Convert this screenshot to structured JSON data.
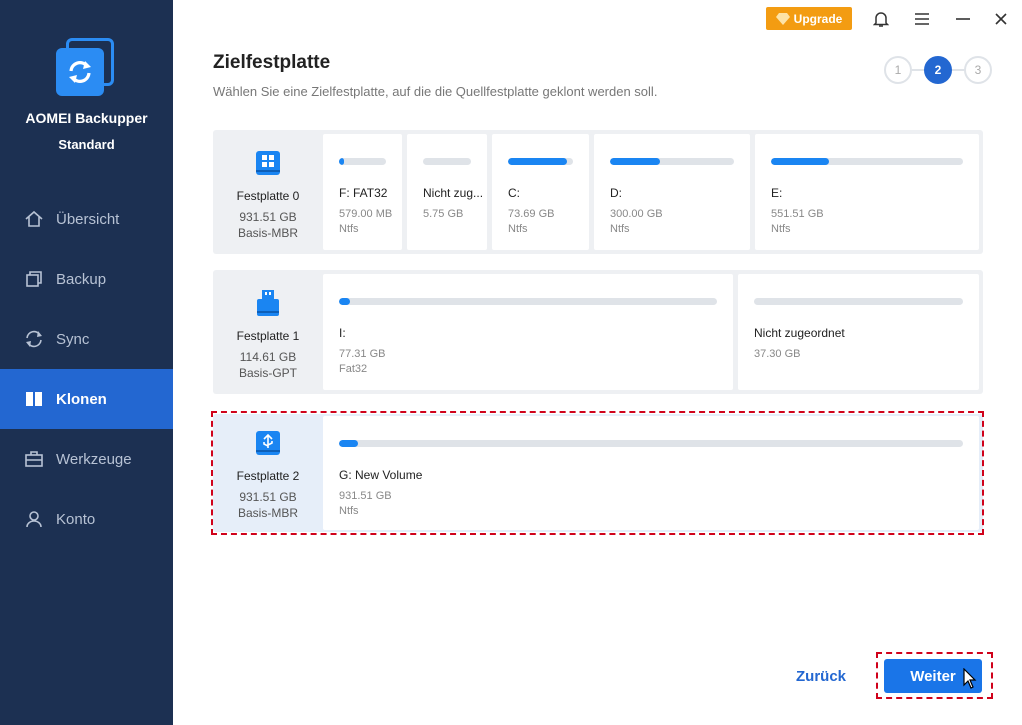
{
  "app": {
    "name": "AOMEI Backupper",
    "edition": "Standard"
  },
  "sidebar": {
    "items": [
      {
        "label": "Übersicht",
        "icon": "home-icon"
      },
      {
        "label": "Backup",
        "icon": "backup-icon"
      },
      {
        "label": "Sync",
        "icon": "sync-icon"
      },
      {
        "label": "Klonen",
        "icon": "clone-icon",
        "active": true
      },
      {
        "label": "Werkzeuge",
        "icon": "toolbox-icon"
      },
      {
        "label": "Konto",
        "icon": "user-icon"
      }
    ]
  },
  "topbar": {
    "upgrade_label": "Upgrade"
  },
  "page": {
    "title": "Zielfestplatte",
    "subtitle": "Wählen Sie eine Zielfestplatte, auf die die Quellfestplatte geklont werden soll."
  },
  "steps": [
    "1",
    "2",
    "3"
  ],
  "active_step": 2,
  "disks": [
    {
      "name": "Festplatte 0",
      "size": "931.51 GB",
      "type": "Basis-MBR",
      "partitions": [
        {
          "label": "F: FAT32",
          "size": "579.00 MB",
          "fs": "Ntfs",
          "used": 0.1
        },
        {
          "label": "Nicht zug...",
          "size": "5.75 GB",
          "fs": "",
          "used": 0
        },
        {
          "label": "C:",
          "size": "73.69 GB",
          "fs": "Ntfs",
          "used": 0.9
        },
        {
          "label": "D:",
          "size": "300.00 GB",
          "fs": "Ntfs",
          "used": 0.4
        },
        {
          "label": "E:",
          "size": "551.51 GB",
          "fs": "Ntfs",
          "used": 0.3
        }
      ]
    },
    {
      "name": "Festplatte 1",
      "size": "114.61 GB",
      "type": "Basis-GPT",
      "partitions": [
        {
          "label": "I:",
          "size": "77.31 GB",
          "fs": "Fat32",
          "used": 0.01
        },
        {
          "label": "Nicht zugeordnet",
          "size": "37.30 GB",
          "fs": "",
          "used": 0
        }
      ]
    },
    {
      "name": "Festplatte 2",
      "size": "931.51 GB",
      "type": "Basis-MBR",
      "partitions": [
        {
          "label": "G: New Volume",
          "size": "931.51 GB",
          "fs": "Ntfs",
          "used": 0.01
        }
      ]
    }
  ],
  "footer": {
    "back_label": "Zurück",
    "next_label": "Weiter"
  },
  "colors": {
    "sidebar": "#1c3052",
    "accent": "#2367d1",
    "upgrade": "#f39c12",
    "highlight": "#d0021b"
  }
}
